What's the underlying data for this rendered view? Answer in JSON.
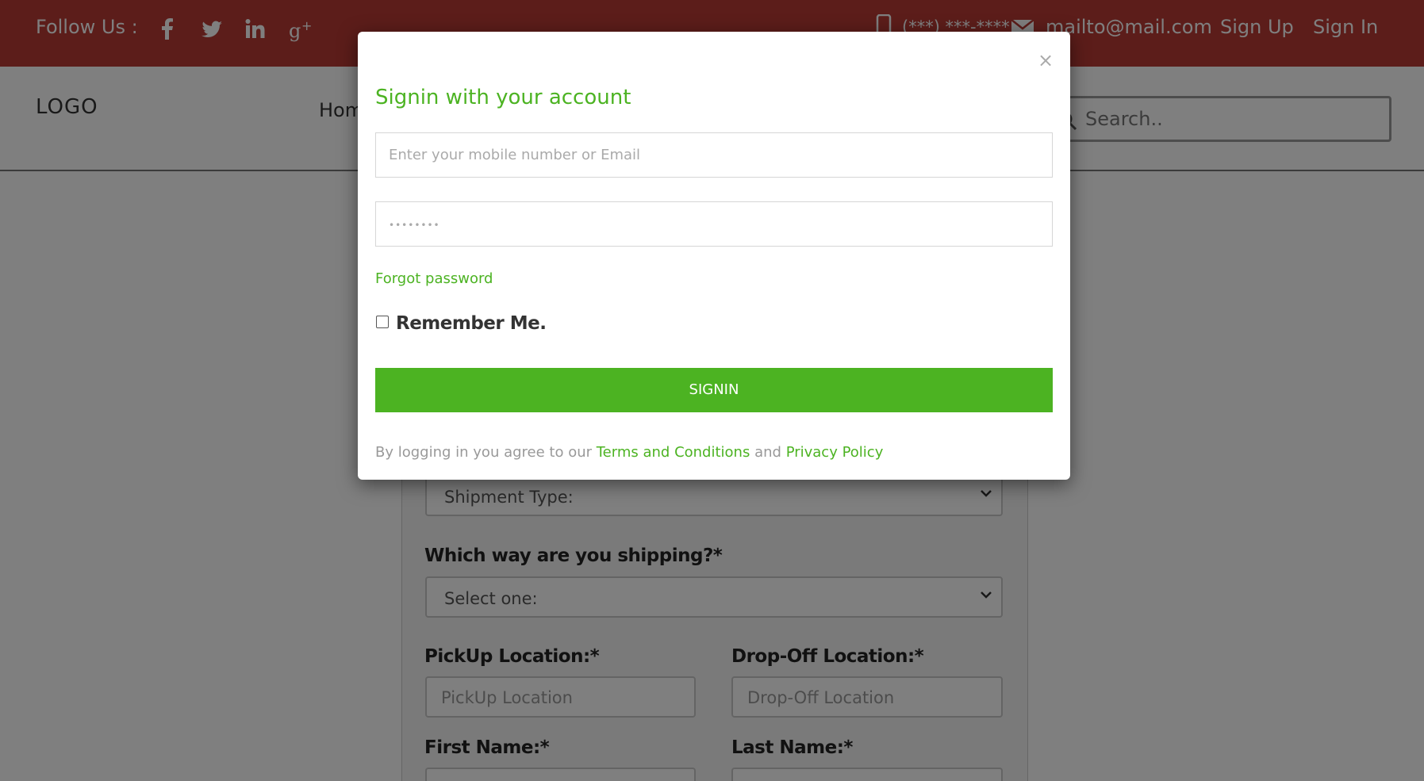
{
  "topbar": {
    "follow_label": "Follow Us :",
    "social_icons": [
      "facebook-icon",
      "twitter-icon",
      "linkedin-icon",
      "google-plus-icon"
    ],
    "phone": "(***) ***-****",
    "email": "mailto@mail.com",
    "signup": "Sign Up",
    "signin": "Sign In",
    "bg_color": "#b83b35"
  },
  "header": {
    "logo": "LOGO",
    "nav_home": "Hom",
    "search_placeholder": "Search.."
  },
  "form": {
    "shipment_type": "Shipment Type:",
    "way_label": "Which way are you shipping?*",
    "way_value": "Select one:",
    "pickup_label": "PickUp Location:*",
    "pickup_placeholder": "PickUp Location",
    "dropoff_label": "Drop-Off Location:*",
    "dropoff_placeholder": "Drop-Off Location",
    "first_name_label": "First Name:*",
    "last_name_label": "Last Name:*"
  },
  "modal": {
    "close": "×",
    "title": "Signin with your account",
    "username_placeholder": "Enter your mobile number or Email",
    "password_placeholder": "••••••••",
    "forgot": "Forgot password",
    "remember": "Remember Me.",
    "signin_button": "SIGNIN",
    "agree_text": "By logging in you agree to our",
    "terms": "Terms and Conditions",
    "and": "and",
    "privacy": "Privacy Policy",
    "accent_color": "#4cb322"
  }
}
